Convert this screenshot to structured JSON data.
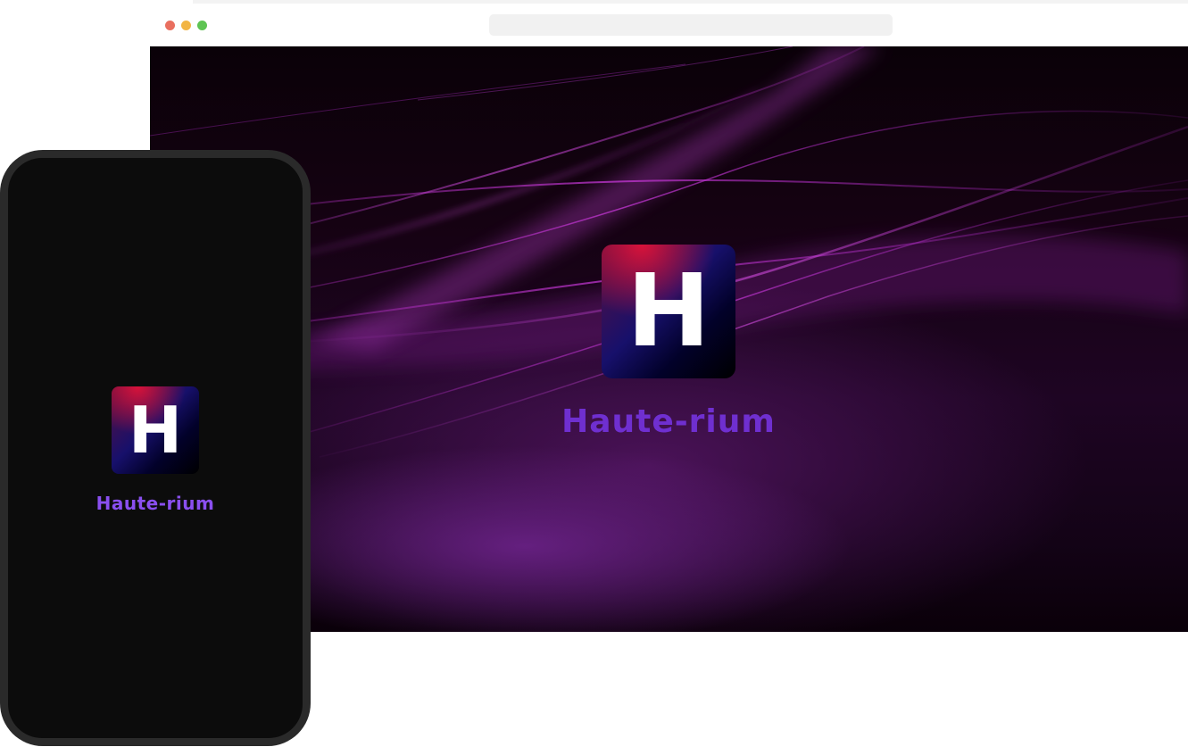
{
  "browser": {
    "address_bar": {
      "value": ""
    },
    "splash": {
      "logo_letter": "H",
      "brand_name": "Haute-rium"
    }
  },
  "phone": {
    "splash": {
      "logo_letter": "H",
      "brand_name": "Haute-rium"
    }
  },
  "colors": {
    "brand_text": "#6f2fd0",
    "brand_text_phone": "#8a4ff0",
    "logo_red": "#d8123a",
    "logo_blue": "#17106b",
    "traffic_red": "#e96f5f",
    "traffic_yellow": "#f2b544",
    "traffic_green": "#5ec453"
  }
}
